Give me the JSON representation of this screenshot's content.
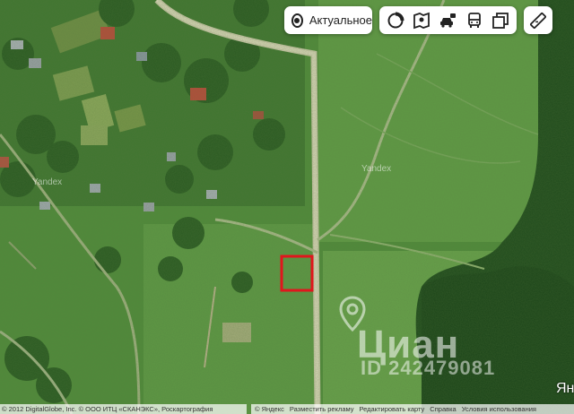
{
  "map": {
    "layer_label": "Актуальное",
    "tools": [
      {
        "icon": "satellite-layer-icon",
        "label": "Слои"
      },
      {
        "icon": "panorama-icon",
        "label": "Панорамы"
      },
      {
        "icon": "traffic-car-icon",
        "label": "Пробки"
      },
      {
        "icon": "transit-bus-icon",
        "label": "Транспорт"
      },
      {
        "icon": "layers-icon",
        "label": "Слои карты"
      }
    ],
    "ruler_icon": "ruler-icon",
    "marker_color": "#e0161d",
    "watermark": "Циан",
    "watermark_id": "ID 242479081",
    "map_labels": [
      "Yandex",
      "Yandex"
    ],
    "corner_logo": "Ян",
    "copyright": "© 2012 DigitalGlobe, Inc. © ООО ИТЦ «СКАНЭКС», Роскартография",
    "footer_links": [
      "© Яндекс",
      "Разместить рекламу",
      "Редактировать карту",
      "Справка",
      "Условия использования"
    ]
  }
}
